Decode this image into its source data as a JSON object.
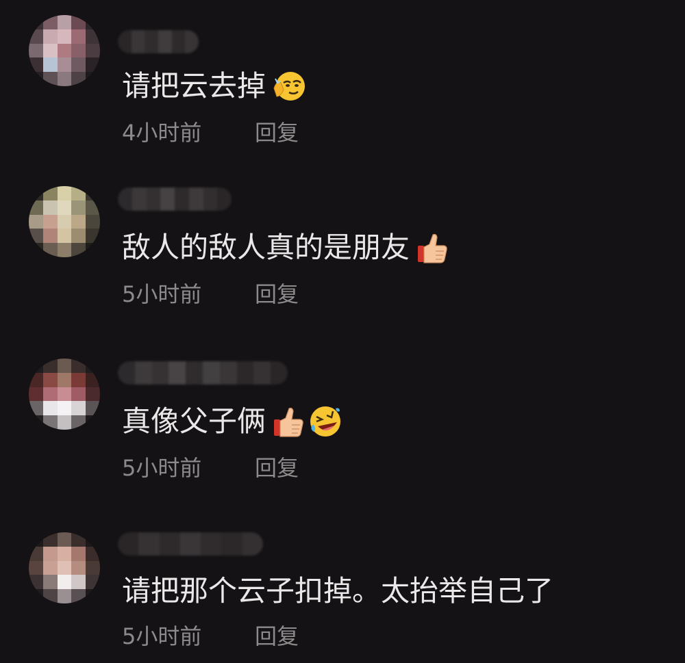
{
  "comments": [
    {
      "text": "请把云去掉",
      "emojis": [
        "saluting-smirk-face-icon"
      ],
      "time": "4小时前",
      "reply_label": "回复",
      "avatar_colors": [
        "#3a3036",
        "#7c5d66",
        "#b8a0a6",
        "#6b4a52",
        "#2c2428",
        "#5a4a50",
        "#c8aab0",
        "#d6b8bc",
        "#9c6a72",
        "#3e3438",
        "#7a6a70",
        "#d8c0c4",
        "#b07a82",
        "#8a6068",
        "#4a3c40",
        "#3c3034",
        "#b6c4d6",
        "#a88e94",
        "#6e5a60",
        "#2a2226",
        "#242024",
        "#5e5256",
        "#8a7a80",
        "#4e4246",
        "#1e1a1e"
      ],
      "username_colors": [
        "#2a2628",
        "#3a3638",
        "#302c2e",
        "#403c3e",
        "#2e2a2c",
        "#383436"
      ]
    },
    {
      "text": "敌人的敌人真的是朋友",
      "emojis": [
        "thumbs-up-icon"
      ],
      "time": "5小时前",
      "reply_label": "回复",
      "avatar_colors": [
        "#2e2a24",
        "#8a8460",
        "#d8d0a8",
        "#b6ae86",
        "#3a3630",
        "#6e6a54",
        "#c8c4b0",
        "#e0d8bc",
        "#9a9478",
        "#5a5648",
        "#a89c88",
        "#c8a090",
        "#d8ccb0",
        "#bca888",
        "#4a463c",
        "#585048",
        "#b08478",
        "#d4c4a4",
        "#9c8c70",
        "#3a362e",
        "#2a2622",
        "#6a5e52",
        "#8c7e68",
        "#4c463c",
        "#1e1c18"
      ],
      "username_colors": [
        "#2c2a2c",
        "#3c383a",
        "#343032",
        "#464244",
        "#2e2a2c",
        "#3e3a3c",
        "#322e30",
        "#2a2628"
      ]
    },
    {
      "text": "真像父子俩",
      "emojis": [
        "thumbs-up-icon",
        "rolling-laughing-face-icon"
      ],
      "time": "5小时前",
      "reply_label": "回复",
      "avatar_colors": [
        "#201c1e",
        "#3a2e2c",
        "#6a5a50",
        "#3a2e2c",
        "#201c1e",
        "#4a2624",
        "#8a4a44",
        "#a07868",
        "#7a3a36",
        "#3a2220",
        "#5e2e30",
        "#b06c74",
        "#c88c94",
        "#a05c64",
        "#4a2a2c",
        "#6a6466",
        "#e8e6e8",
        "#f4f2f4",
        "#d8d4d6",
        "#5a5456",
        "#242022",
        "#7a7476",
        "#c4c0c2",
        "#6a6466",
        "#1e1a1c"
      ],
      "username_colors": [
        "#2c2a2c",
        "#3e3a3c",
        "#363234",
        "#484446",
        "#302c2e",
        "#424040",
        "#3a3638",
        "#2c282a",
        "#363234",
        "#2a2628"
      ]
    },
    {
      "text": "请把那个云子扣掉。太抬举自己了",
      "emojis": [],
      "time": "5小时前",
      "reply_label": "回复",
      "avatar_colors": [
        "#1e1a1c",
        "#3c302e",
        "#6c5a54",
        "#3a2e2c",
        "#1c181a",
        "#4a3a36",
        "#c49a8c",
        "#d8b0a2",
        "#a4786c",
        "#3a2c2a",
        "#5a4440",
        "#c8a094",
        "#e0c0b4",
        "#b48c80",
        "#4a3a36",
        "#3c3234",
        "#8a7a78",
        "#f2eeee",
        "#d0c8c6",
        "#3e3436",
        "#201c1e",
        "#4e4446",
        "#9a9092",
        "#585052",
        "#1e1a1c"
      ],
      "username_colors": [
        "#2a2628",
        "#363234",
        "#2e2a2c",
        "#3a3638",
        "#302c2e",
        "#2c282a",
        "#343032"
      ]
    }
  ]
}
